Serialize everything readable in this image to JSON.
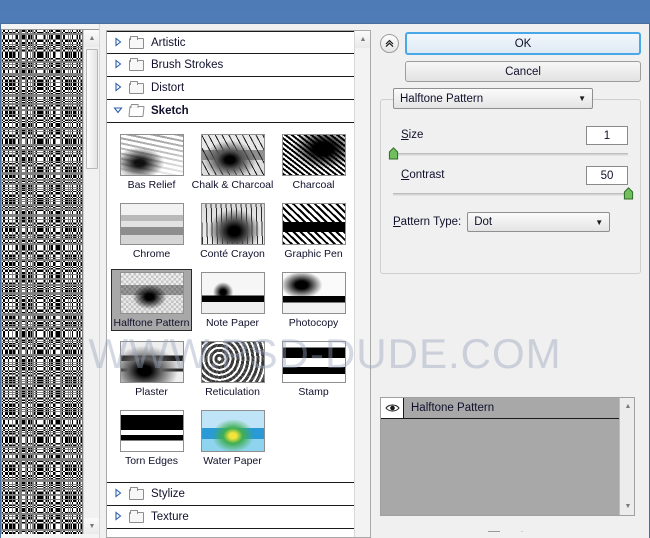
{
  "window": {
    "watermark": "WWW.PSD-DUDE.COM"
  },
  "preview": {
    "name": "filter-preview",
    "pattern": "halftone-dot-pattern"
  },
  "filter_browser": {
    "categories_top": [
      {
        "label": "Artistic",
        "expanded": false,
        "icon": "folder-closed-icon",
        "triangle": "triangle-right-icon"
      },
      {
        "label": "Brush Strokes",
        "expanded": false,
        "icon": "folder-closed-icon",
        "triangle": "triangle-right-icon"
      },
      {
        "label": "Distort",
        "expanded": false,
        "icon": "folder-closed-icon",
        "triangle": "triangle-right-icon"
      },
      {
        "label": "Sketch",
        "expanded": true,
        "icon": "folder-open-icon",
        "triangle": "triangle-down-icon"
      }
    ],
    "thumbnails": [
      {
        "label": "Bas Relief",
        "selected": false,
        "tex": "tx-basrelief"
      },
      {
        "label": "Chalk & Charcoal",
        "selected": false,
        "tex": "tx-chalk"
      },
      {
        "label": "Charcoal",
        "selected": false,
        "tex": "tx-charcoal"
      },
      {
        "label": "Chrome",
        "selected": false,
        "tex": "tx-chrome"
      },
      {
        "label": "Conté Crayon",
        "selected": false,
        "tex": "tx-conte"
      },
      {
        "label": "Graphic Pen",
        "selected": false,
        "tex": "tx-graphicpen"
      },
      {
        "label": "Halftone Pattern",
        "selected": true,
        "tex": "tx-halftone"
      },
      {
        "label": "Note Paper",
        "selected": false,
        "tex": "tx-notepaper"
      },
      {
        "label": "Photocopy",
        "selected": false,
        "tex": "tx-photocopy"
      },
      {
        "label": "Plaster",
        "selected": false,
        "tex": "tx-plaster"
      },
      {
        "label": "Reticulation",
        "selected": false,
        "tex": "tx-reticulation"
      },
      {
        "label": "Stamp",
        "selected": false,
        "tex": "tx-stamp"
      },
      {
        "label": "Torn Edges",
        "selected": false,
        "tex": "tx-tornedges"
      },
      {
        "label": "Water Paper",
        "selected": false,
        "tex": "tx-waterpaper"
      }
    ],
    "categories_bottom": [
      {
        "label": "Stylize",
        "expanded": false,
        "icon": "folder-closed-icon",
        "triangle": "triangle-right-icon"
      },
      {
        "label": "Texture",
        "expanded": false,
        "icon": "folder-closed-icon",
        "triangle": "triangle-right-icon"
      }
    ]
  },
  "settings": {
    "collapse_icon": "double-chevron-up-icon",
    "ok_label": "OK",
    "cancel_label": "Cancel",
    "filter_select": {
      "value": "Halftone Pattern",
      "caret": "chevron-down-icon"
    },
    "sliders": [
      {
        "label_accel": "S",
        "label_rest": "ize",
        "value": "1",
        "percent": 0
      },
      {
        "label_accel": "C",
        "label_rest": "ontrast",
        "value": "50",
        "percent": 100
      }
    ],
    "pattern_type": {
      "label_accel": "P",
      "label_rest": "attern Type:",
      "value": "Dot",
      "caret": "chevron-down-icon"
    }
  },
  "layers": {
    "rows": [
      {
        "name": "Halftone Pattern",
        "visible": true,
        "eye_icon": "eye-icon"
      }
    ],
    "tools": [
      {
        "icon": "new-effect-layer-icon"
      },
      {
        "icon": "delete-effect-layer-icon"
      }
    ]
  },
  "colors": {
    "accent_blue": "#4aa8e8",
    "desktop": "#5c87c0",
    "selection_gray": "#a8a8a8",
    "slider_green": "#4e9b43"
  }
}
